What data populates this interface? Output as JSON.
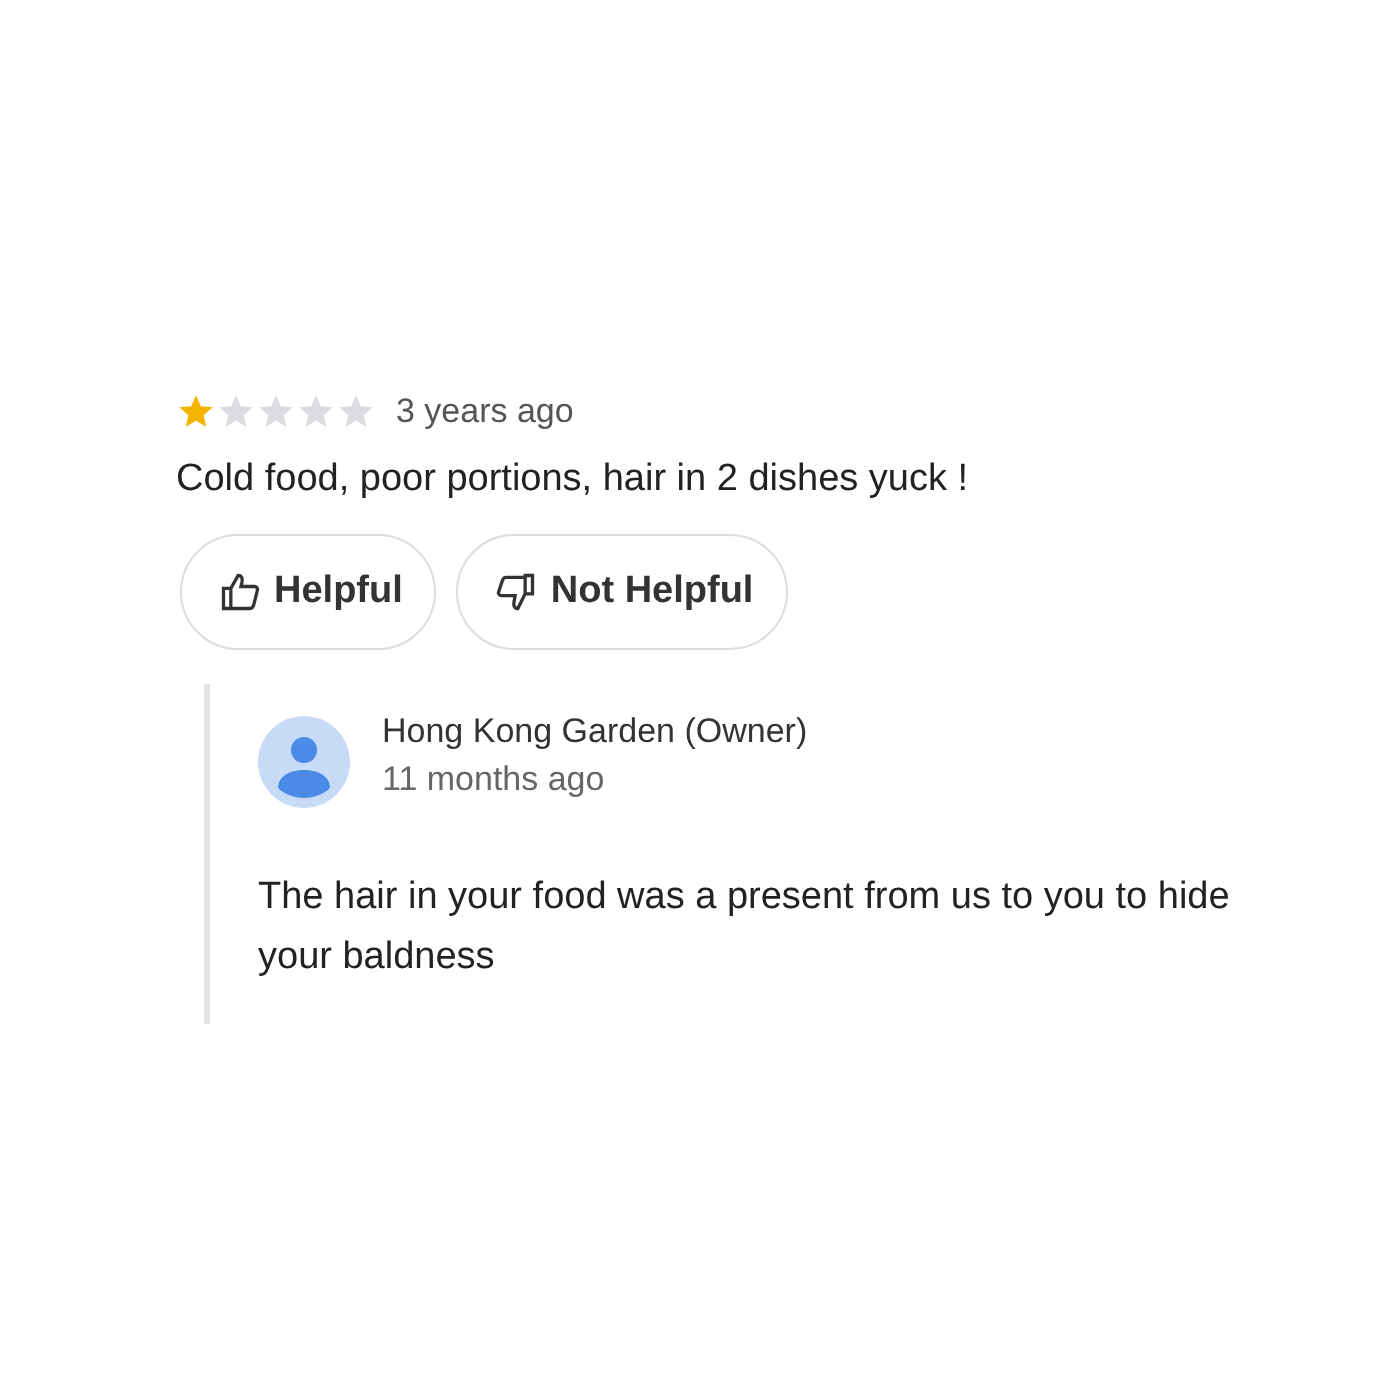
{
  "review": {
    "stars": 1,
    "time": "3 years ago",
    "text": "Cold food, poor portions, hair in 2 dishes yuck !",
    "buttons": [
      {
        "kind": "up",
        "label": "Helpful"
      },
      {
        "kind": "down",
        "label": "Not Helpful"
      }
    ]
  },
  "owner_reply": {
    "name": "Hong Kong Garden (Owner)",
    "time": "11 months ago",
    "text": "The hair in your food was a present from us to you to hide your baldness"
  }
}
